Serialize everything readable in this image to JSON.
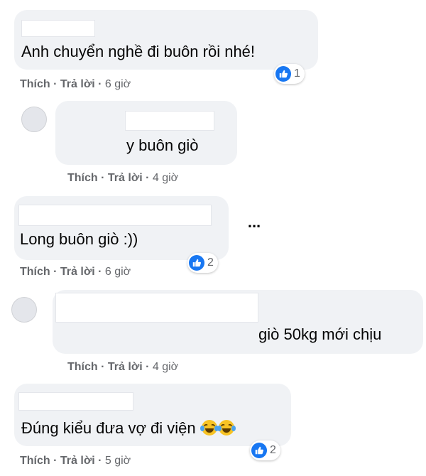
{
  "comments": [
    {
      "text": "Anh chuyển nghề đi buôn rồi nhé!",
      "like_label": "Thích",
      "reply_label": "Trả lời",
      "time": "6 giờ",
      "reactions": {
        "count": "1",
        "icon": "like-icon"
      }
    },
    {
      "text": "y buôn giò",
      "like_label": "Thích",
      "reply_label": "Trả lời",
      "time": "4 giờ"
    },
    {
      "text": "Long buôn giò :))",
      "like_label": "Thích",
      "reply_label": "Trả lời",
      "time": "6 giờ",
      "reactions": {
        "count": "2",
        "icon": "like-icon"
      }
    },
    {
      "text": "giò 50kg mới chịu",
      "like_label": "Thích",
      "reply_label": "Trả lời",
      "time": "4 giờ"
    },
    {
      "text": "Đúng kiểu đưa vợ đi viện",
      "like_label": "Thích",
      "reply_label": "Trả lời",
      "time": "5 giờ",
      "emojis": [
        "laughing-tears-emoji",
        "laughing-tears-emoji"
      ],
      "reactions": {
        "count": "2",
        "icon": "like-icon"
      }
    }
  ],
  "separator": "·",
  "more_options": "...",
  "colors": {
    "like_blue": "#1877f2",
    "bubble_bg": "#f0f2f5",
    "meta_gray": "#65676b"
  }
}
